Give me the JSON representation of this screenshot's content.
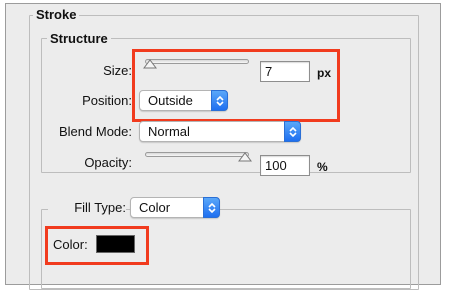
{
  "stroke": {
    "title": "Stroke",
    "structure": {
      "title": "Structure",
      "size_label": "Size:",
      "size_value": "7",
      "size_unit": "px",
      "size_slider_level": 0.02,
      "position_label": "Position:",
      "position_value": "Outside",
      "blend_mode_label": "Blend Mode:",
      "blend_mode_value": "Normal",
      "opacity_label": "Opacity:",
      "opacity_value": "100",
      "opacity_unit": "%",
      "opacity_slider_level": 1.0
    },
    "fill": {
      "fill_type_label": "Fill Type:",
      "fill_type_value": "Color",
      "color_label": "Color:",
      "color_value": "#000000"
    }
  },
  "colors": {
    "highlight": "#f13b1e",
    "accent": "#2f7cf6",
    "panel_bg": "#ececec"
  }
}
